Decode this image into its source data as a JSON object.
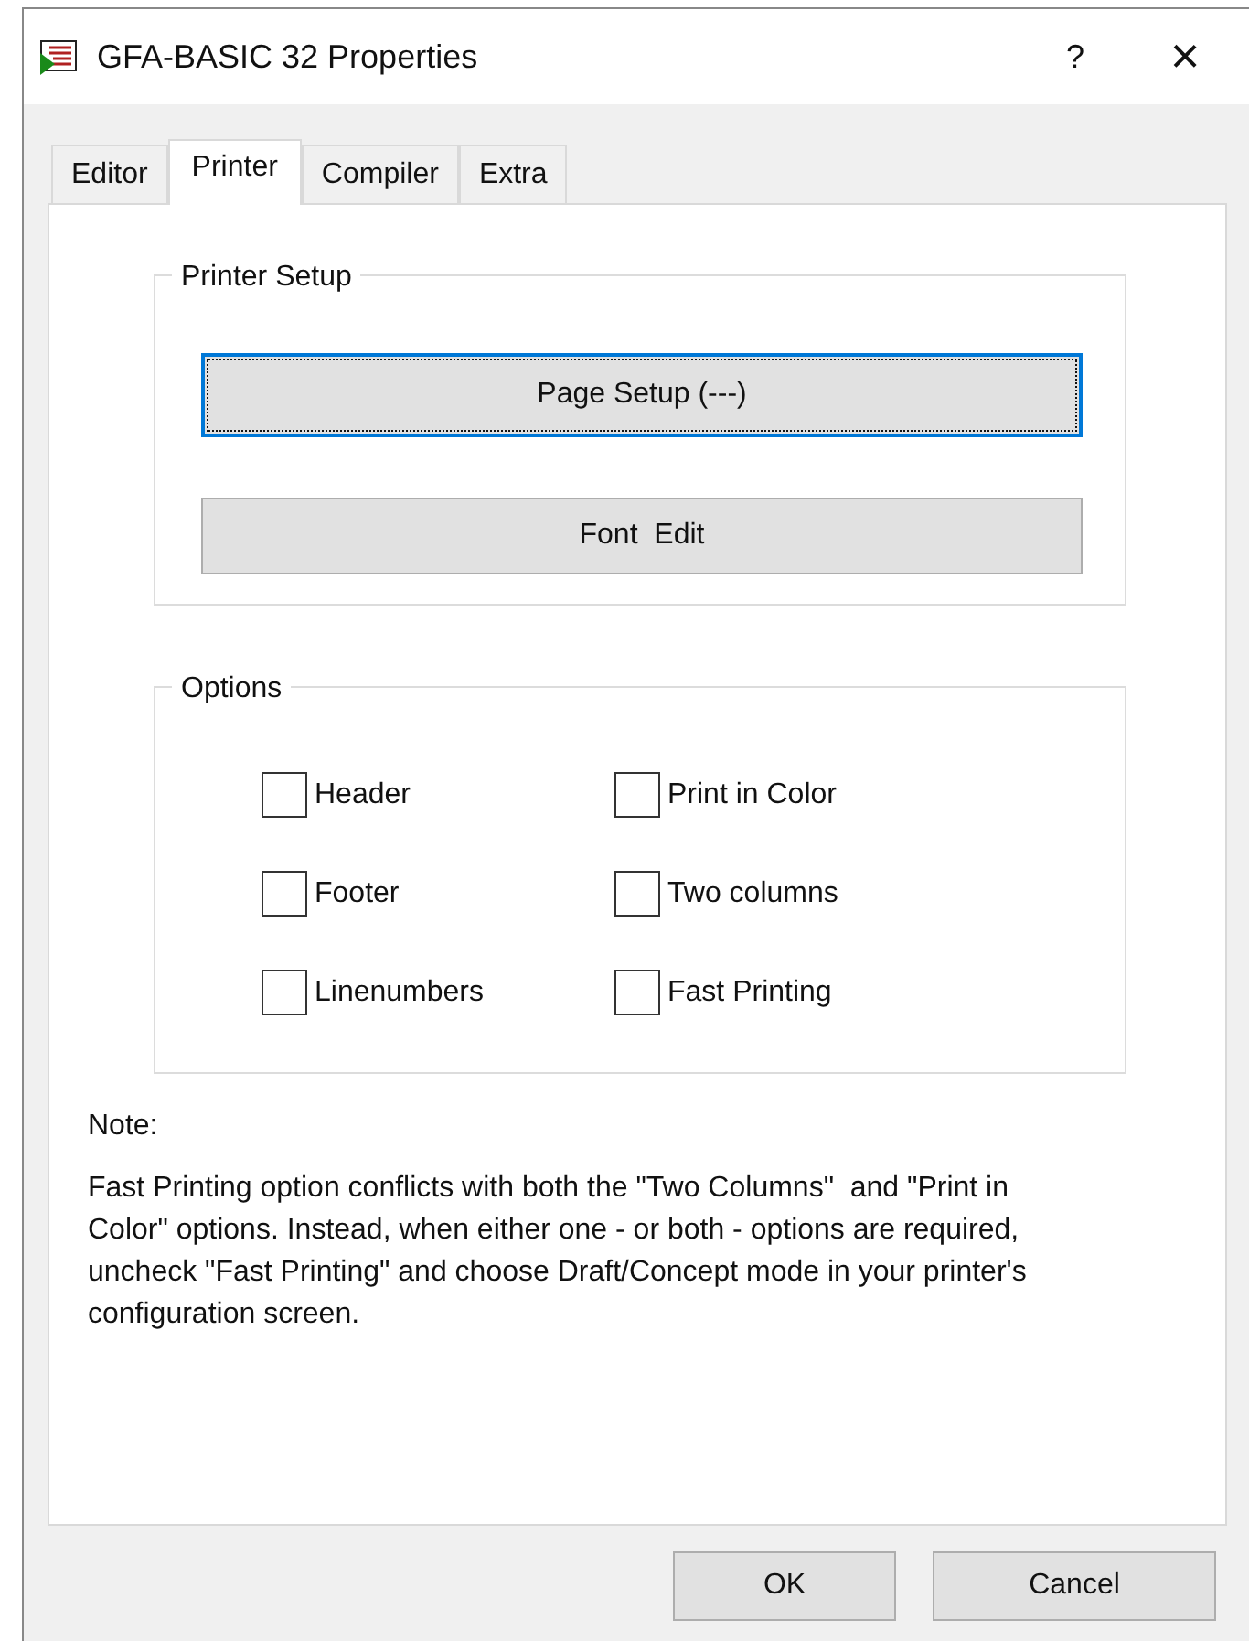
{
  "window": {
    "title": "GFA-BASIC 32 Properties",
    "help": "?",
    "close": "×"
  },
  "tabs": [
    {
      "label": "Editor",
      "selected": false
    },
    {
      "label": "Printer",
      "selected": true
    },
    {
      "label": "Compiler",
      "selected": false
    },
    {
      "label": "Extra",
      "selected": false
    }
  ],
  "printer_setup": {
    "title": "Printer Setup",
    "buttons": [
      {
        "label": "Page Setup (---)",
        "focused": true
      },
      {
        "label": "Font  Edit",
        "focused": false
      }
    ]
  },
  "options": {
    "title": "Options",
    "checkboxes": [
      {
        "label": "Header",
        "checked": false
      },
      {
        "label": "Print in Color",
        "checked": false
      },
      {
        "label": "Footer",
        "checked": false
      },
      {
        "label": "Two columns",
        "checked": false
      },
      {
        "label": "Linenumbers",
        "checked": false
      },
      {
        "label": "Fast Printing",
        "checked": false
      }
    ]
  },
  "note": {
    "title": "Note:",
    "text": "Fast Printing option conflicts with both the \"Two Columns\"  and \"Print in Color\" options. Instead, when either one - or both - options are required, uncheck \"Fast Printing\" and choose Draft/Concept mode in your printer's configuration screen."
  },
  "buttons": [
    "OK",
    "Cancel"
  ]
}
